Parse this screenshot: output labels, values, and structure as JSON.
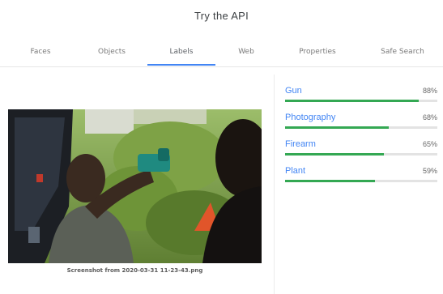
{
  "page": {
    "title": "Try the API"
  },
  "tabs": [
    {
      "label": "Faces"
    },
    {
      "label": "Objects"
    },
    {
      "label": "Labels",
      "active": true
    },
    {
      "label": "Web"
    },
    {
      "label": "Properties"
    },
    {
      "label": "Safe Search"
    }
  ],
  "image": {
    "caption": "Screenshot from 2020-03-31 11-23-43.png"
  },
  "labels": [
    {
      "name": "Gun",
      "score": "88%",
      "value": 0.88
    },
    {
      "name": "Photography",
      "score": "68%",
      "value": 0.68
    },
    {
      "name": "Firearm",
      "score": "65%",
      "value": 0.65
    },
    {
      "name": "Plant",
      "score": "59%",
      "value": 0.59
    }
  ],
  "colors": {
    "accent": "#4285f4",
    "bar": "#34a853"
  }
}
